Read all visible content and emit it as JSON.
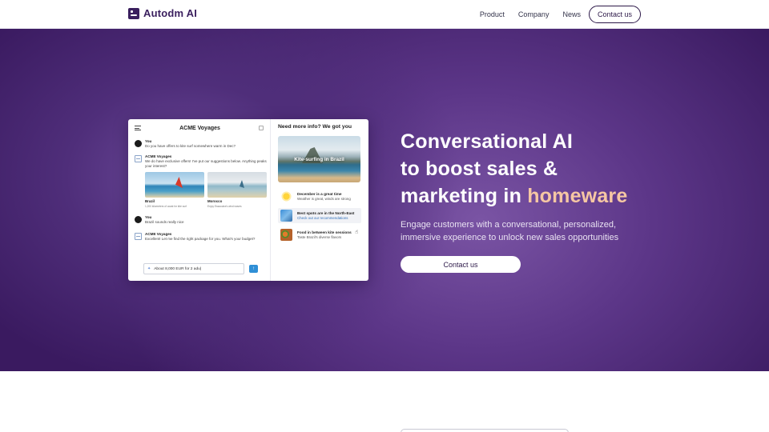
{
  "header": {
    "brand": "Autodm AI",
    "nav": [
      {
        "label": "Product"
      },
      {
        "label": "Company"
      },
      {
        "label": "News"
      }
    ],
    "cta_label": "Contact us"
  },
  "hero": {
    "headline_line1": "Conversational AI",
    "headline_line2": "to boost sales &",
    "headline_line3_prefix": "marketing in ",
    "headline_accent": "homeware",
    "subcopy": "Engage customers with a conversational, personalized, immersive experience to unlock new sales opportunities",
    "cta_label": "Contact us"
  },
  "demo": {
    "chat_title": "ACME Voyages",
    "messages": [
      {
        "author": "You",
        "text": "Do you have offers to kite surf somewhere warm in Dec?"
      },
      {
        "author": "ACME Voyages",
        "text": "We do have exclusive offers! I've put our suggestions below. Anything peaks your interest?"
      },
      {
        "author": "You",
        "text": "Brazil sounds really nice"
      },
      {
        "author": "ACME Voyages",
        "text": "Excellent! Let me find the right package for you. What's your budget?"
      }
    ],
    "destinations": [
      {
        "name": "Brazil",
        "sub": "1,200 kilometers of coast for kite surf"
      },
      {
        "name": "Morocco",
        "sub": "Enjoy Essaouira's wind waves"
      }
    ],
    "input_value": "About 8,000 EUR for 2 adu|",
    "info_title": "Need more info? We got you",
    "info_hero_label": "Kite-surfing in Brazil",
    "info_items": [
      {
        "title": "December is a great time",
        "sub": "Weather is great, winds are strong"
      },
      {
        "title": "Best spots are in the North-East",
        "sub": "Check out our recommendations"
      },
      {
        "title": "Food in between kite sessions",
        "sub": "Taste Brazil's diverse flavors"
      }
    ]
  },
  "colors": {
    "brand": "#3a1f5e",
    "hero_bg": "#4a2774",
    "accent": "#f6c7a3"
  }
}
